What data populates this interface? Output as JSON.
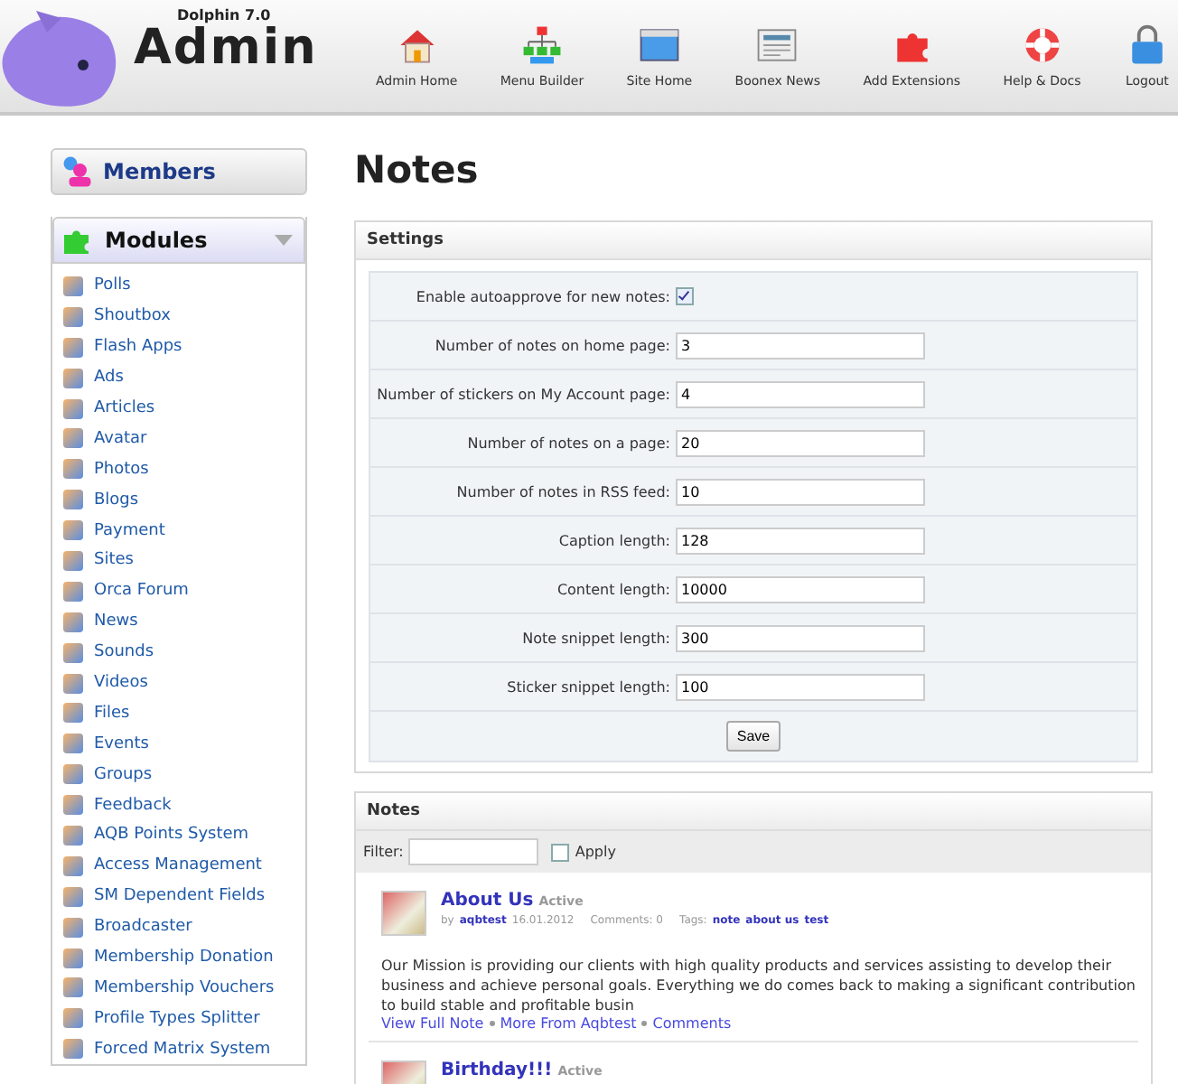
{
  "header": {
    "version": "Dolphin 7.0",
    "logo": "Admin",
    "nav": [
      {
        "label": "Admin Home"
      },
      {
        "label": "Menu Builder"
      },
      {
        "label": "Site Home"
      },
      {
        "label": "Boonex News"
      },
      {
        "label": "Add Extensions"
      },
      {
        "label": "Help & Docs"
      },
      {
        "label": "Logout"
      }
    ]
  },
  "sidebar": {
    "members": {
      "title": "Members"
    },
    "modules": {
      "title": "Modules",
      "expanded": true,
      "items": [
        "Polls",
        "Shoutbox",
        "Flash Apps",
        "Ads",
        "Articles",
        "Avatar",
        "Photos",
        "Blogs",
        "Payment",
        "Sites",
        "Orca Forum",
        "News",
        "Sounds",
        "Videos",
        "Files",
        "Events",
        "Groups",
        "Feedback",
        "AQB Points System",
        "Access Management",
        "SM Dependent Fields",
        "Broadcaster",
        "Membership Donation",
        "Membership Vouchers",
        "Profile Types Splitter",
        "Forced Matrix System"
      ]
    }
  },
  "page_title": "Notes",
  "settings": {
    "title": "Settings",
    "fields": [
      {
        "kind": "checkbox",
        "label": "Enable autoapprove for new notes:",
        "checked": true
      },
      {
        "kind": "text",
        "label": "Number of notes on home page:",
        "value": "3"
      },
      {
        "kind": "text",
        "label": "Number of stickers on My Account page:",
        "value": "4"
      },
      {
        "kind": "text",
        "label": "Number of notes on a page:",
        "value": "20"
      },
      {
        "kind": "text",
        "label": "Number of notes in RSS feed:",
        "value": "10"
      },
      {
        "kind": "text",
        "label": "Caption length:",
        "value": "128"
      },
      {
        "kind": "text",
        "label": "Content length:",
        "value": "10000"
      },
      {
        "kind": "text",
        "label": "Note snippet length:",
        "value": "300"
      },
      {
        "kind": "text",
        "label": "Sticker snippet length:",
        "value": "100"
      }
    ],
    "save_button": "Save"
  },
  "notes": {
    "title": "Notes",
    "filter_label": "Filter:",
    "apply": {
      "label": "Apply",
      "checked": false
    },
    "items": [
      {
        "title": "About Us",
        "status": "Active",
        "by": "by",
        "author": "aqbtest",
        "date": "16.01.2012",
        "comments": "Comments: 0",
        "tags_label": "Tags:",
        "tags": [
          "note",
          "about us",
          "test"
        ],
        "snippet": "Our Mission is providing our clients with high quality products and services assisting to develop their business and achieve personal goals. Everything we do comes back to making a significant contribution to build stable and profitable busin",
        "links": [
          "View Full Note",
          "More From Aqbtest",
          "Comments"
        ]
      },
      {
        "title": "Birthday!!!",
        "status": "Active"
      }
    ]
  }
}
